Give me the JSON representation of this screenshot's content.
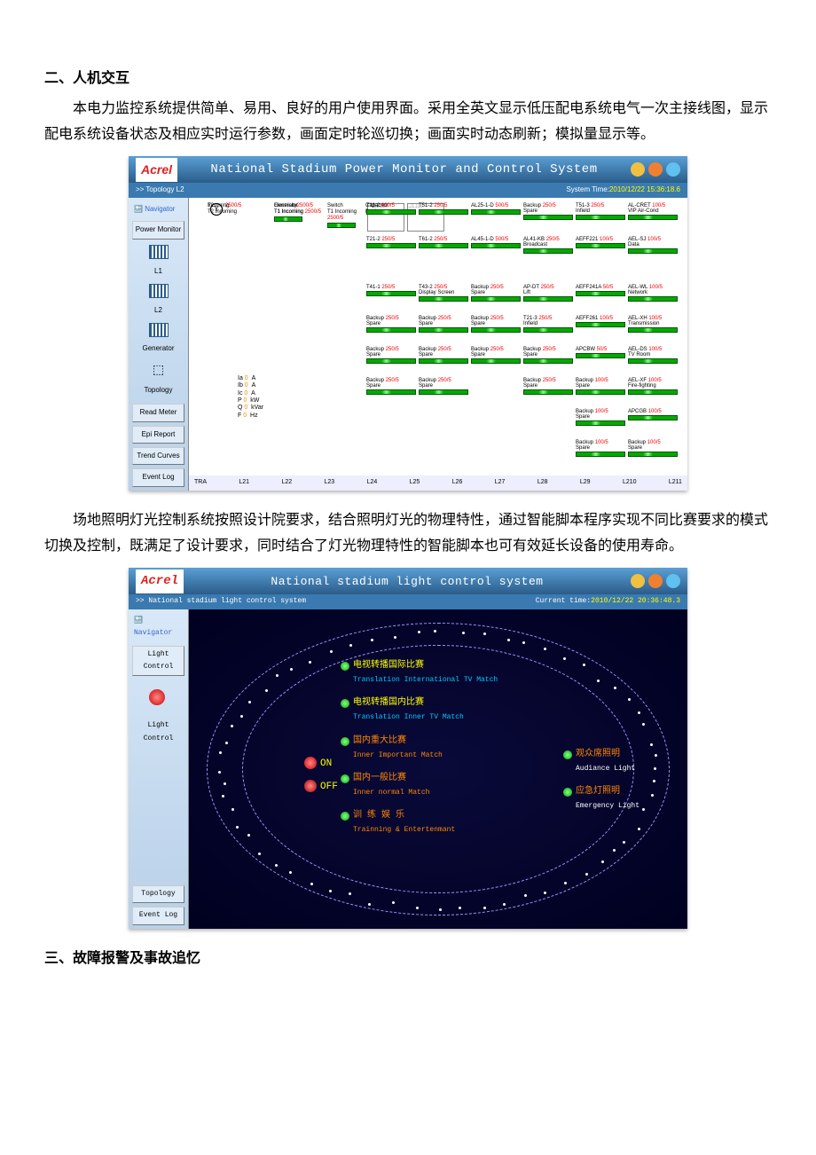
{
  "heading2": "二、人机交互",
  "para1": "本电力监控系统提供简单、易用、良好的用户使用界面。采用全英文显示低压配电系统电气一次主接线图，显示配电系统设备状态及相应实时运行参数，画面定时轮巡切换；画面实时动态刷新；模拟量显示等。",
  "screenshot1": {
    "logo": "Acrel",
    "title": "National Stadium Power Monitor and Control System",
    "breadcrumb": ">> Topology L2",
    "system_time_label": "System Time:",
    "system_time": "2010/12/22 15:36:18.6",
    "nav_head": "Navigator",
    "nav": {
      "power_monitor": "Power Monitor",
      "l1": "L1",
      "l2": "L2",
      "generator": "Generator",
      "topology": "Topology",
      "read_meter": "Read Meter",
      "epi_report": "Epi Report",
      "trend_curves": "Trend Curves",
      "event_log": "Event Log"
    },
    "node_labels": {
      "electricity": "Electricity",
      "t1_incoming": "T1 Incoming",
      "switch": "Switch",
      "generator": "Generator",
      "capacitor": "Capacitor Bank",
      "t2": "T2",
      "t2_incoming": "T2 Incoming",
      "incoming": "Incoming"
    },
    "readings": [
      {
        "label": "Ia",
        "val": "0",
        "unit": "A"
      },
      {
        "label": "Ib",
        "val": "0",
        "unit": "A"
      },
      {
        "label": "Ic",
        "val": "0",
        "unit": "A"
      },
      {
        "label": "P",
        "val": "0",
        "unit": "kW"
      },
      {
        "label": "Q",
        "val": "0",
        "unit": "kVar"
      },
      {
        "label": "F",
        "val": "0",
        "unit": "Hz"
      }
    ],
    "ct_ratios": [
      "2500/5",
      "500/5",
      "400/5",
      "250/5",
      "100/5",
      "50/5"
    ],
    "feeders": [
      [
        {
          "name": "T11-2",
          "ct": "400/5"
        },
        {
          "name": "T51-2",
          "ct": "250/5"
        },
        {
          "name": "AL25-1-D",
          "ct": "500/5"
        },
        {
          "name": "Backup\nSpare",
          "ct": "250/5"
        },
        {
          "name": "T51-3\nInfield",
          "ct": "250/5"
        },
        {
          "name": "AL-CRET\nVIP Air-Cond",
          "ct": "100/5"
        }
      ],
      [
        {
          "name": "T21-2",
          "ct": "250/5"
        },
        {
          "name": "T61-2",
          "ct": "250/5"
        },
        {
          "name": "AL45-1-D",
          "ct": "500/5"
        },
        {
          "name": "AL41-KB\nBroadcast",
          "ct": "250/5"
        },
        {
          "name": "AEFF221",
          "ct": "100/5"
        },
        {
          "name": "AEL-SJ\nData",
          "ct": "100/5"
        }
      ],
      [
        {
          "name": "T41-1",
          "ct": "250/5"
        },
        {
          "name": "T43-2\nDisplay Screen",
          "ct": "250/5"
        },
        {
          "name": "Backup\nSpare",
          "ct": "250/5"
        },
        {
          "name": "AP-DT\nLift",
          "ct": "250/5"
        },
        {
          "name": "AEFF241A",
          "ct": "50/5"
        },
        {
          "name": "AEL-WL\nNetwork",
          "ct": "100/5"
        }
      ],
      [
        {
          "name": "Backup\nSpare",
          "ct": "250/5"
        },
        {
          "name": "Backup\nSpare",
          "ct": "250/5"
        },
        {
          "name": "Backup\nSpare",
          "ct": "250/5"
        },
        {
          "name": "T21-3\nInfield",
          "ct": "250/5"
        },
        {
          "name": "AEFF261",
          "ct": "100/5"
        },
        {
          "name": "AEL-XH\nTransmission",
          "ct": "100/5"
        }
      ],
      [
        {
          "name": "Backup\nSpare",
          "ct": "250/5"
        },
        {
          "name": "Backup\nSpare",
          "ct": "250/5"
        },
        {
          "name": "Backup\nSpare",
          "ct": "250/5"
        },
        {
          "name": "Backup\nSpare",
          "ct": "250/5"
        },
        {
          "name": "APCBW",
          "ct": "50/5"
        },
        {
          "name": "AEL-DS\nTV Room",
          "ct": "100/5"
        }
      ],
      [
        {
          "name": "Backup\nSpare",
          "ct": "250/5"
        },
        {
          "name": "Backup\nSpare",
          "ct": "250/5"
        },
        {
          "name": " ",
          "ct": " "
        },
        {
          "name": "Backup\nSpare",
          "ct": "250/5"
        },
        {
          "name": "Backup\nSpare",
          "ct": "100/5"
        },
        {
          "name": "AEL-XF\nFire-fighting",
          "ct": "100/5"
        }
      ],
      [
        {
          "name": " ",
          "ct": " "
        },
        {
          "name": " ",
          "ct": " "
        },
        {
          "name": " ",
          "ct": " "
        },
        {
          "name": " ",
          "ct": " "
        },
        {
          "name": "Backup\nSpare",
          "ct": "100/5"
        },
        {
          "name": "APCGB",
          "ct": "100/5"
        }
      ],
      [
        {
          "name": " ",
          "ct": " "
        },
        {
          "name": " ",
          "ct": " "
        },
        {
          "name": " ",
          "ct": " "
        },
        {
          "name": " ",
          "ct": " "
        },
        {
          "name": "Backup\nSpare",
          "ct": "100/5"
        },
        {
          "name": "Backup\nSpare",
          "ct": "100/5"
        }
      ]
    ],
    "xaxis": [
      "TRA",
      "L21",
      "L22",
      "L23",
      "L24",
      "L25",
      "L26",
      "L27",
      "L28",
      "L29",
      "L210",
      "L211"
    ]
  },
  "para2": "场地照明灯光控制系统按照设计院要求，结合照明灯光的物理特性，通过智能脚本程序实现不同比赛要求的模式切换及控制，既满足了设计要求，同时结合了灯光物理特性的智能脚本也可有效延长设备的使用寿命。",
  "screenshot2": {
    "logo": "Acrel",
    "title": "National stadium light control system",
    "breadcrumb": ">> National stadium light control system",
    "current_time_label": "Current time:",
    "current_time": "2010/12/22 20:36:48.3",
    "nav_head": "Navigator",
    "nav": {
      "light_control_btn": "Light Control",
      "light_control_label": "Light Control",
      "topology": "Topology",
      "event_log": "Event Log"
    },
    "on_label": "ON",
    "off_label": "OFF",
    "modes": [
      {
        "cn": "电视转播国际比赛",
        "en": "Translation International TV Match",
        "color": "normal"
      },
      {
        "cn": "电视转播国内比赛",
        "en": "Translation Inner TV Match",
        "color": "normal"
      },
      {
        "cn": "国内重大比赛",
        "en": "Inner Important Match",
        "color": "orange"
      },
      {
        "cn": "国内一般比赛",
        "en": "Inner normal Match",
        "color": "orange"
      },
      {
        "cn": "训 练 娱 乐",
        "en": "Trainning & Entertenmant",
        "color": "orange"
      }
    ],
    "right_modes": [
      {
        "cn": "观众席照明",
        "en": "Audiance Light"
      },
      {
        "cn": "应急灯照明",
        "en": "Emergency Light"
      }
    ]
  },
  "heading3": "三、故障报警及事故追忆"
}
